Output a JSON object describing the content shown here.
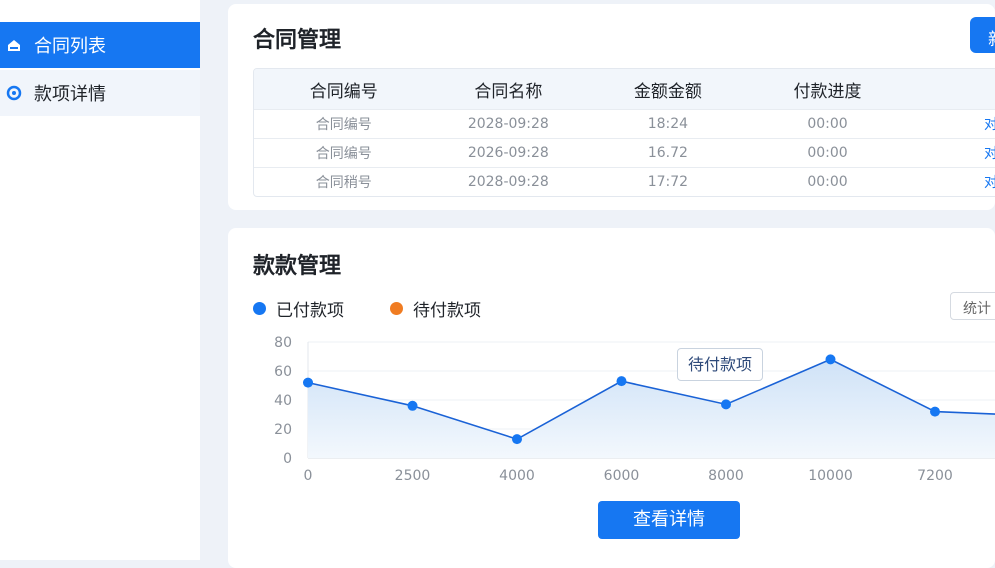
{
  "sidebar": {
    "items": [
      {
        "label": "合同列表",
        "icon": "home-icon",
        "active": true
      },
      {
        "label": "款项详情",
        "icon": "target-icon",
        "active": false
      }
    ]
  },
  "contracts": {
    "title": "合同管理",
    "new_button": "新",
    "columns": [
      "合同编号",
      "合同名称",
      "金额金额",
      "付款进度",
      ""
    ],
    "rows": [
      [
        "合同编号",
        "2028-09:28",
        "18:24",
        "00:00",
        "对重"
      ],
      [
        "合同编号",
        "2026-09:28",
        "16.72",
        "00:00",
        "对重"
      ],
      [
        "合同稍号",
        "2028-09:28",
        "17:72",
        "00:00",
        "对重"
      ]
    ]
  },
  "payments": {
    "title": "款款管理",
    "stat_button": "统计",
    "detail_button": "查看详情",
    "tooltip": "待付款项",
    "legend": [
      {
        "label": "已付款项",
        "color": "#1677f2"
      },
      {
        "label": "待付款项",
        "color": "#f07c22"
      }
    ]
  },
  "chart_data": {
    "type": "area",
    "categories": [
      "0",
      "2500",
      "4000",
      "6000",
      "8000",
      "10000",
      "7200",
      ""
    ],
    "series": [
      {
        "name": "已付款项",
        "values": [
          52,
          36,
          13,
          53,
          37,
          68,
          32,
          29
        ]
      }
    ],
    "yticks": [
      "0",
      "20",
      "40",
      "60",
      "80"
    ],
    "ylim": [
      0,
      80
    ],
    "grid": true
  }
}
